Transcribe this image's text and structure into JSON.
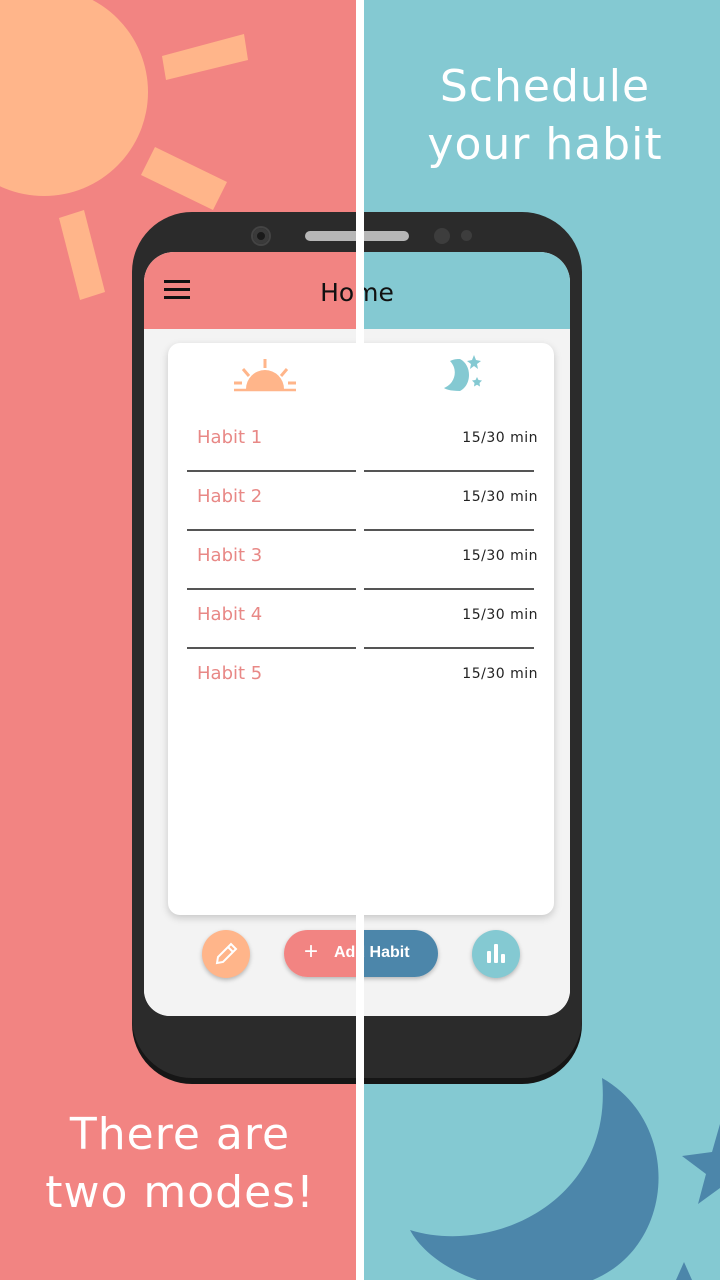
{
  "captions": {
    "top": [
      "Schedule",
      "your habit"
    ],
    "bottom": [
      "There are",
      "two modes!"
    ]
  },
  "app": {
    "title": "Home",
    "menu_icon": "hamburger-menu-icon",
    "day_mode_icon": "sunrise-icon",
    "night_mode_icon": "moon-stars-icon",
    "habits": [
      {
        "name": "Habit 1",
        "progress": "15/30 min"
      },
      {
        "name": "Habit 2",
        "progress": "15/30 min"
      },
      {
        "name": "Habit 3",
        "progress": "15/30 min"
      },
      {
        "name": "Habit 4",
        "progress": "15/30 min"
      },
      {
        "name": "Habit 5",
        "progress": "15/30 min"
      }
    ],
    "buttons": {
      "edit_icon": "pencil-icon",
      "add_habit_label": "Add Habit",
      "stats_icon": "bar-chart-icon"
    }
  },
  "colors": {
    "day_background": "#f28482",
    "night_background": "#84c9d2",
    "sun": "#ffb58a",
    "moon": "#4c86aa",
    "day_text": "#e88886",
    "phone_body": "#2b2b2b",
    "screen_bg": "#f3f3f3"
  }
}
